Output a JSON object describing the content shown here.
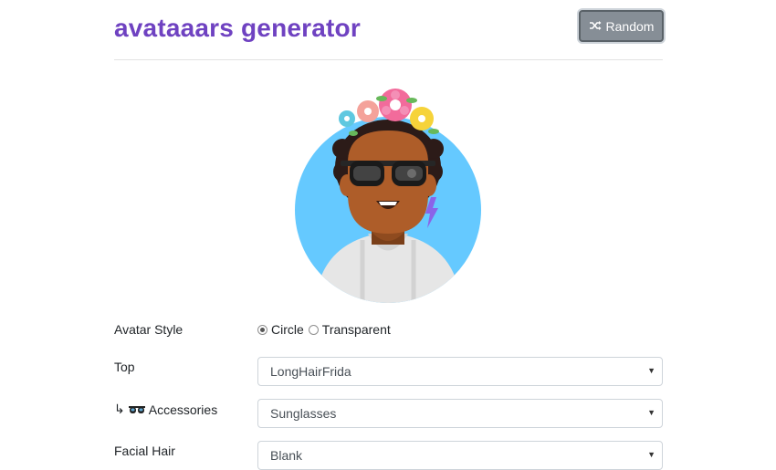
{
  "header": {
    "title": "avataaars generator",
    "random_label": "Random",
    "random_icon": "shuffle-icon"
  },
  "avatar": {
    "description_icon": "avatar-preview",
    "background_color": "#65c9ff",
    "skin_color": "#ae5d29",
    "hair_color": "#2c1b18",
    "clothing_color": "#e6e6e6"
  },
  "form": {
    "avatar_style": {
      "label": "Avatar Style",
      "options": [
        "Circle",
        "Transparent"
      ],
      "selected": "Circle"
    },
    "top": {
      "label": "Top",
      "value": "LongHairFrida"
    },
    "accessories": {
      "prefix": "↳",
      "icon": "sunglasses-icon",
      "label": "Accessories",
      "value": "Sunglasses"
    },
    "facial_hair": {
      "label": "Facial Hair",
      "value": "Blank"
    }
  }
}
